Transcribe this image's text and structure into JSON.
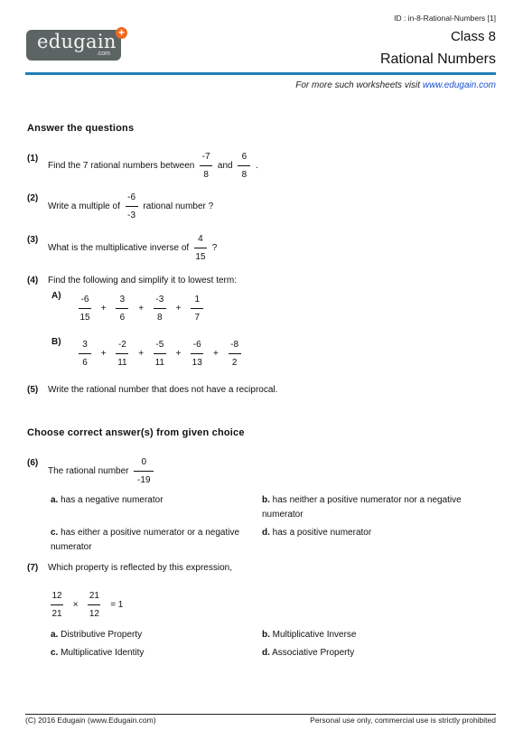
{
  "header": {
    "logo_text": "edugain",
    "logo_sub": ".com",
    "logo_plus": "+",
    "doc_id": "ID : in-8-Rational-Numbers [1]",
    "class_label": "Class 8",
    "topic": "Rational Numbers",
    "more_prefix": "For more such worksheets visit ",
    "more_link": "www.edugain.com"
  },
  "sections": [
    {
      "title": "Answer the questions"
    },
    {
      "title": "Choose correct answer(s) from given choice"
    }
  ],
  "questions": {
    "q1": {
      "num": "(1)",
      "text_before": "Find the 7 rational numbers between",
      "f1": {
        "num": "-7",
        "den": "8"
      },
      "mid": "and",
      "f2": {
        "num": "6",
        "den": "8"
      },
      "end": "."
    },
    "q2": {
      "num": "(2)",
      "text_before": "Write a multiple of",
      "f1": {
        "num": "-6",
        "den": "-3"
      },
      "text_after": "rational number ?"
    },
    "q3": {
      "num": "(3)",
      "text_before": "What is the multiplicative inverse of",
      "f1": {
        "num": "4",
        "den": "15"
      },
      "text_after": "?"
    },
    "q4": {
      "num": "(4)",
      "text": "Find the following and simplify it to lowest term:",
      "parts": [
        {
          "label": "A)",
          "op": "+",
          "fractions": [
            {
              "num": "-6",
              "den": "15"
            },
            {
              "num": "3",
              "den": "6"
            },
            {
              "num": "-3",
              "den": "8"
            },
            {
              "num": "1",
              "den": "7"
            }
          ]
        },
        {
          "label": "B)",
          "op": "+",
          "fractions": [
            {
              "num": "3",
              "den": "6"
            },
            {
              "num": "-2",
              "den": "11"
            },
            {
              "num": "-5",
              "den": "11"
            },
            {
              "num": "-6",
              "den": "13"
            },
            {
              "num": "-8",
              "den": "2"
            }
          ]
        }
      ]
    },
    "q5": {
      "num": "(5)",
      "text": "Write the rational number that does not have a reciprocal."
    },
    "q6": {
      "num": "(6)",
      "text_before": "The rational number",
      "f1": {
        "num": "0",
        "den": "-19"
      },
      "choices": [
        {
          "letter": "a.",
          "text": "has a negative numerator"
        },
        {
          "letter": "b.",
          "text": "has neither a positive numerator nor a negative numerator"
        },
        {
          "letter": "c.",
          "text": "has either a positive numerator or a negative numerator"
        },
        {
          "letter": "d.",
          "text": "has a positive numerator"
        }
      ]
    },
    "q7": {
      "num": "(7)",
      "text": "Which property is reflected by this expression,",
      "f1": {
        "num": "12",
        "den": "21"
      },
      "op": "×",
      "f2": {
        "num": "21",
        "den": "12"
      },
      "result": "= 1",
      "choices": [
        {
          "letter": "a.",
          "text": "Distributive Property"
        },
        {
          "letter": "b.",
          "text": "Multiplicative Inverse"
        },
        {
          "letter": "c.",
          "text": "Multiplicative Identity"
        },
        {
          "letter": "d.",
          "text": "Associative Property"
        }
      ]
    }
  },
  "footer": {
    "left": "(C) 2016 Edugain (www.Edugain.com)",
    "right": "Personal use only, commercial use is strictly prohibited"
  }
}
